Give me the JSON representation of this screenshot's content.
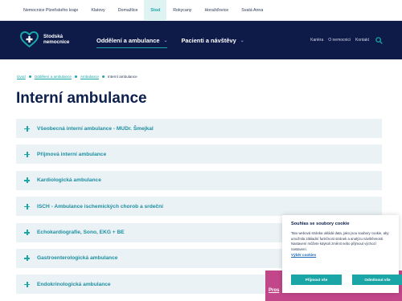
{
  "topbar": {
    "links": [
      {
        "label": "Nemocnice Plzeňského kraje",
        "active": false
      },
      {
        "label": "Klatovy",
        "active": false
      },
      {
        "label": "Domažlice",
        "active": false
      },
      {
        "label": "Stod",
        "active": true
      },
      {
        "label": "Rokycany",
        "active": false
      },
      {
        "label": "Horažďovice",
        "active": false
      },
      {
        "label": "Svatá Anna",
        "active": false
      }
    ]
  },
  "header": {
    "logo_line1": "Stodská",
    "logo_line2": "nemocnice",
    "nav": [
      {
        "label": "Oddělení a ambulance",
        "active": true
      },
      {
        "label": "Pacienti a návštěvy",
        "active": false
      }
    ],
    "util": [
      "Kariéra",
      "O nemocnici",
      "Kontakt"
    ]
  },
  "breadcrumb": [
    "Úvod",
    "Oddělení a ambulance",
    "Ambulance",
    "Interní ambulance"
  ],
  "page_title": "Interní ambulance",
  "accordion": [
    "Všeobecná interní ambulance - MUDr. Šmejkal",
    "Příjmová interní ambulance",
    "Kardiologická ambulance",
    "ISCH - Ambulance ischemických chorob a srdeční",
    "Echokardiografie, Sono, EKG + BE",
    "Gastroenterologická ambulance",
    "Endokrinologická ambulance"
  ],
  "pink_banner": {
    "text": "Pros"
  },
  "cookie": {
    "title": "Souhlas se soubory cookie",
    "text": "Tato webová stránka ukládá data, jako jsou soubory cookie, aby umožnila základní funkčnost stránek a analýzu návštěvnosti. Nastavení můžete kdykoli změnit nebo přijmout výchozí nastavení.",
    "link": "Výběr cookies",
    "accept_label": "Přijmout vše",
    "reject_label": "Odmítnout vše"
  },
  "colors": {
    "navy": "#0e1a48",
    "teal": "#1aa5a7",
    "accordion_bg": "#eaf2f5",
    "pink": "#c2478a"
  },
  "icons": [
    "heart-cross-logo-icon",
    "chevron-down-icon",
    "search-icon",
    "plus-icon"
  ]
}
